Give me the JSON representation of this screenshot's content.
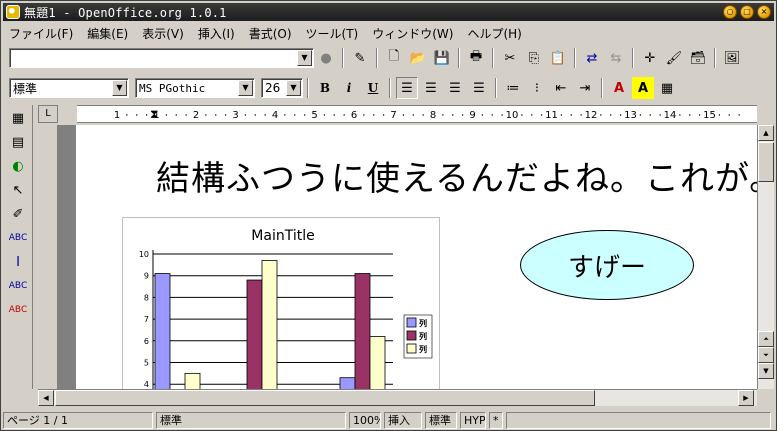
{
  "window": {
    "title": "無題1 - OpenOffice.org 1.0.1",
    "controls": [
      "○",
      "□",
      "×"
    ]
  },
  "menu": [
    "ファイル(F)",
    "編集(E)",
    "表示(V)",
    "挿入(I)",
    "書式(O)",
    "ツール(T)",
    "ウィンドウ(W)",
    "ヘルプ(H)"
  ],
  "toolbar": {
    "url_value": ""
  },
  "formatting": {
    "style_value": "標準",
    "font_value": "MS PGothic",
    "size_value": "26",
    "bold_label": "B",
    "italic_label": "i",
    "underline_label": "U"
  },
  "ruler": {
    "numbers": [
      "1",
      "1",
      "2",
      "3",
      "4",
      "5",
      "6",
      "7",
      "8",
      "9",
      "10",
      "11",
      "12",
      "13",
      "14",
      "15"
    ]
  },
  "document": {
    "heading_text": "結構ふつうに使えるんだよね。これが。",
    "bubble_text": "すげー"
  },
  "colors": {
    "bubble_fill": "#ccffff",
    "page_bg": "#ffffff",
    "desktop_bg": "#808080",
    "chrome": "#d4d0c8"
  },
  "chart_data": {
    "type": "bar",
    "title": "MainTitle",
    "ylim": [
      4,
      10
    ],
    "yticks": [
      "10",
      "9",
      "8",
      "7",
      "6",
      "5",
      "4"
    ],
    "series": [
      {
        "name": "列",
        "color": "#9999ff",
        "values": [
          9.1,
          null,
          null,
          4.3
        ]
      },
      {
        "name": "列",
        "color": "#993366",
        "values": [
          null,
          8.8,
          null,
          9.1
        ]
      },
      {
        "name": "列",
        "color": "#ffffcc",
        "values": [
          4.5,
          9.7,
          null,
          6.2
        ]
      }
    ]
  },
  "status": {
    "page": "ページ 1 / 1",
    "style": "標準",
    "zoom": "100%",
    "mode": "挿入",
    "selection": "標準",
    "hyphen": "HYP",
    "modified": "*"
  }
}
